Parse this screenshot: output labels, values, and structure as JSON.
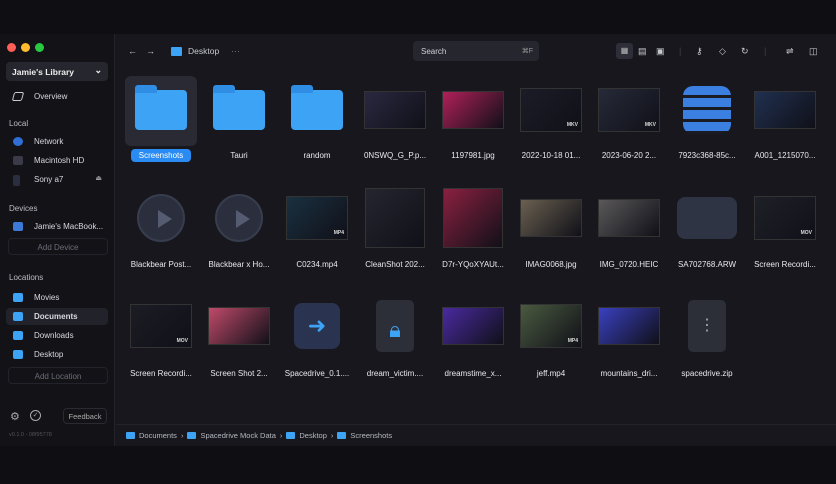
{
  "sidebar": {
    "library": "Jamie's Library",
    "overview": "Overview",
    "local_title": "Local",
    "local": [
      "Network",
      "Macintosh HD",
      "Sony a7"
    ],
    "devices_title": "Devices",
    "device": "Jamie's MacBook...",
    "add_device": "Add Device",
    "locations_title": "Locations",
    "locations": [
      "Movies",
      "Documents",
      "Downloads",
      "Desktop"
    ],
    "add_location": "Add Location",
    "feedback": "Feedback",
    "version": "v0.1.0 - 08f95778"
  },
  "toolbar": {
    "location": "Desktop",
    "more": "···",
    "search_placeholder": "Search",
    "search_shortcut": "⌘F"
  },
  "items": [
    {
      "name": "Screenshots",
      "kind": "folder",
      "selected": true
    },
    {
      "name": "Tauri",
      "kind": "folder"
    },
    {
      "name": "random",
      "kind": "folder"
    },
    {
      "name": "0NSWQ_G_P.p...",
      "kind": "image",
      "color": "#2a2840"
    },
    {
      "name": "1197981.jpg",
      "kind": "image",
      "color": "#b0205a"
    },
    {
      "name": "2022-10-18 01...",
      "kind": "video",
      "color": "#1c1c28",
      "badge": "MKV"
    },
    {
      "name": "2023-06-20 2...",
      "kind": "video",
      "color": "#262a38",
      "badge": "MKV"
    },
    {
      "name": "7923c368-85c...",
      "kind": "database"
    },
    {
      "name": "A001_1215070...",
      "kind": "image",
      "color": "#203050"
    },
    {
      "name": "Blackbear Post...",
      "kind": "play"
    },
    {
      "name": "Blackbear x Ho...",
      "kind": "play"
    },
    {
      "name": "C0234.mp4",
      "kind": "video",
      "color": "#1a3040",
      "badge": "MP4"
    },
    {
      "name": "CleanShot 202...",
      "kind": "image",
      "color": "#252530",
      "tall": true
    },
    {
      "name": "D7r-YQoXYAUt...",
      "kind": "image",
      "color": "#8a2040",
      "tall": true
    },
    {
      "name": "IMAG0068.jpg",
      "kind": "image",
      "color": "#6a6050"
    },
    {
      "name": "IMG_0720.HEIC",
      "kind": "image",
      "color": "#5a5858"
    },
    {
      "name": "SA702768.ARW",
      "kind": "raw"
    },
    {
      "name": "Screen Recordi...",
      "kind": "video",
      "color": "#1e2028",
      "badge": "MOV"
    },
    {
      "name": "Screen Recordi...",
      "kind": "video",
      "color": "#1c1d24",
      "badge": "MOV"
    },
    {
      "name": "Screen Shot 2...",
      "kind": "image",
      "color": "#c04a6a"
    },
    {
      "name": "Spacedrive_0.1....",
      "kind": "app"
    },
    {
      "name": "dream_victim....",
      "kind": "lock"
    },
    {
      "name": "dreamstime_x...",
      "kind": "image",
      "color": "#4a2aa0"
    },
    {
      "name": "jeff.mp4",
      "kind": "video",
      "color": "#4a5a40",
      "badge": "MP4"
    },
    {
      "name": "mountains_dri...",
      "kind": "image",
      "color": "#3a40c0"
    },
    {
      "name": "spacedrive.zip",
      "kind": "zip"
    }
  ],
  "breadcrumb": [
    "Documents",
    "Spacedrive Mock Data",
    "Desktop",
    "Screenshots"
  ],
  "colors": {
    "accent": "#2a8bf2",
    "folder": "#3da3f5",
    "background": "#17171d",
    "sidebar": "#121217"
  }
}
